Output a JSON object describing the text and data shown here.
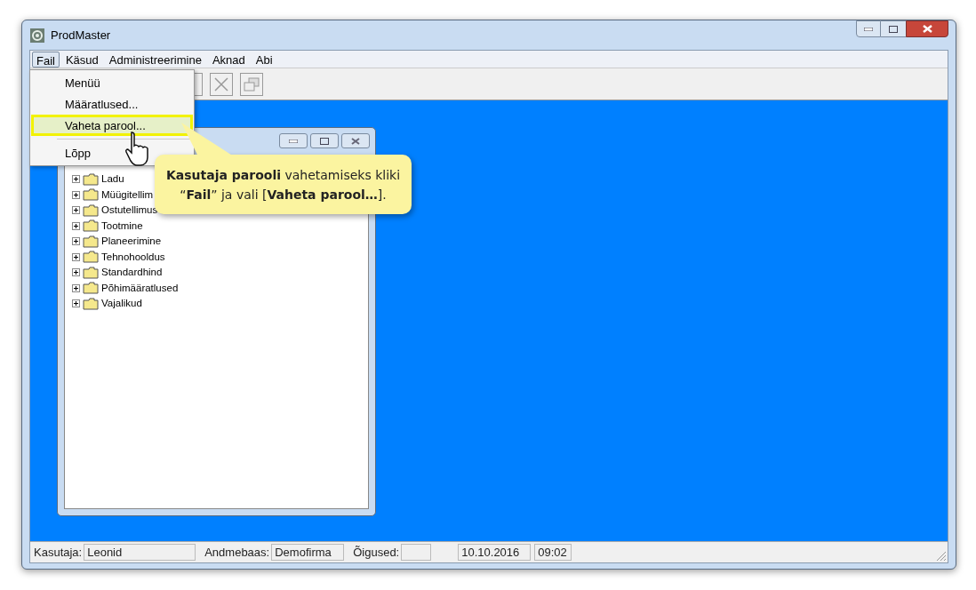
{
  "window": {
    "title": "ProdMaster"
  },
  "menu_bar": [
    {
      "label": "Fail",
      "selected": true
    },
    {
      "label": "Käsud",
      "selected": false
    },
    {
      "label": "Administreerimine",
      "selected": false
    },
    {
      "label": "Aknad",
      "selected": false
    },
    {
      "label": "Abi",
      "selected": false
    }
  ],
  "file_menu": [
    {
      "kind": "item",
      "label": "Menüü",
      "selected": false
    },
    {
      "kind": "item",
      "label": "Määratlused...",
      "selected": false
    },
    {
      "kind": "item",
      "label": "Vaheta parool...",
      "selected": true
    },
    {
      "kind": "separator"
    },
    {
      "kind": "item",
      "label": "Lõpp",
      "selected": false
    }
  ],
  "child_window": {
    "tree": [
      {
        "label": "Ladu",
        "expanded": false
      },
      {
        "label": "Müügitellim",
        "expanded": false
      },
      {
        "label": "Ostutellimus",
        "expanded": false
      },
      {
        "label": "Tootmine",
        "expanded": false
      },
      {
        "label": "Planeerimine",
        "expanded": false
      },
      {
        "label": "Tehnohooldus",
        "expanded": false
      },
      {
        "label": "Standardhind",
        "expanded": false
      },
      {
        "label": "Põhimääratlused",
        "expanded": false
      },
      {
        "label": "Vajalikud",
        "expanded": false
      }
    ]
  },
  "callout": {
    "text": "**Kasutaja parooli** vahetamiseks kliki “**Fail**” ja vali [**Vaheta parool…**]."
  },
  "status_bar": [
    {
      "kind": "field",
      "label": "Kasutaja:",
      "value": "Leonid"
    },
    {
      "kind": "field",
      "label": "Andmebaas:",
      "value": "Demofirma"
    },
    {
      "kind": "field",
      "label": "Õigused:"
    },
    {
      "kind": "value",
      "value": "10.10.2016"
    },
    {
      "kind": "value",
      "value": "09:02"
    }
  ]
}
